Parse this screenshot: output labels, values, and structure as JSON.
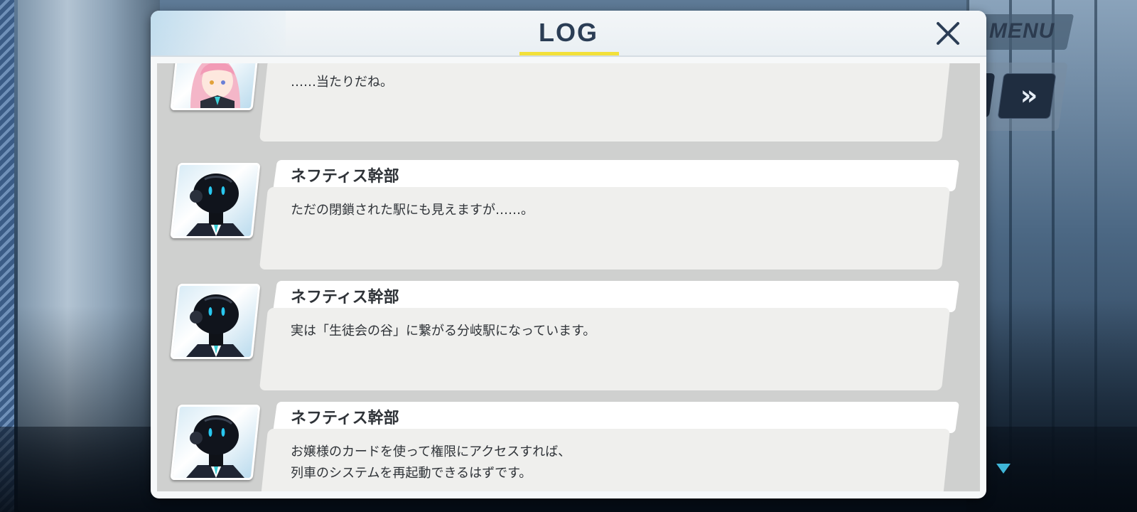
{
  "hud": {
    "menu_label": "MENU",
    "fast_forward_icon": "double-chevron-right-icon",
    "next_indicator_icon": "triangle-down-icon"
  },
  "log": {
    "title": "LOG",
    "close_icon": "close-x-icon",
    "entries": [
      {
        "speaker": "",
        "portrait": "pink-haired-student-avatar",
        "text": "……当たりだね。"
      },
      {
        "speaker": "ネフティス幹部",
        "portrait": "black-robot-avatar",
        "text": "ただの閉鎖された駅にも見えますが……。"
      },
      {
        "speaker": "ネフティス幹部",
        "portrait": "black-robot-avatar",
        "text": "実は「生徒会の谷」に繋がる分岐駅になっています。"
      },
      {
        "speaker": "ネフティス幹部",
        "portrait": "black-robot-avatar",
        "text": "お嬢様のカードを使って権限にアクセスすれば、\n列車のシステムを再起動できるはずです。"
      }
    ]
  },
  "colors": {
    "title_text": "#2b3d55",
    "title_underline": "#f2e03a",
    "robot_eyes": "#28c8f0",
    "tie": "#3fd0d8"
  }
}
